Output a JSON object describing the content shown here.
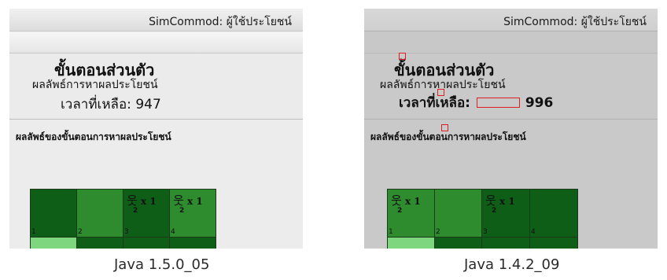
{
  "panels": [
    {
      "window_title": "SimCommod: ผู้ใช้ประโยชน์",
      "main_heading": "ขั้นตอนส่วนตัว",
      "sub_heading": "ผลลัพธ์การหาผลประโยชน์",
      "time_label": "เวลาที่เหลือ:",
      "time_value": "947",
      "results_title": "ผลลัพธ์ของขั้นตอนการหาผลประโยชน์",
      "grid_cells": [
        {
          "number": "1",
          "color": "#0e5e17",
          "agent_label": "",
          "agent_count": ""
        },
        {
          "number": "2",
          "color": "#2e8b2e",
          "agent_label": "",
          "agent_count": ""
        },
        {
          "number": "3",
          "color": "#0e5e17",
          "agent_label": "x 1",
          "agent_count": "2"
        },
        {
          "number": "4",
          "color": "#2e8b2e",
          "agent_label": "x 1",
          "agent_count": "2"
        }
      ],
      "grid_row2_colors": [
        "#7ed67e",
        "#0e5e17",
        "#0e5e17",
        "#0e5e17"
      ],
      "caption": "Java 1.5.0_05"
    },
    {
      "window_title": "SimCommod: ผู้ใช้ประโยชน์",
      "main_heading": "ขั้นตอนส่วนตัว",
      "sub_heading": "ผลลัพธ์การหาผลประโยชน์",
      "time_label": "เวลาที่เหลือ:",
      "time_value": "996",
      "results_title": "ผลลัพธ์ของขั้นตอนการหาผลประโยชน์",
      "grid_cells": [
        {
          "number": "1",
          "color": "#2e8b2e",
          "agent_label": "x 1",
          "agent_count": "2"
        },
        {
          "number": "2",
          "color": "#2e8b2e",
          "agent_label": "",
          "agent_count": ""
        },
        {
          "number": "3",
          "color": "#0e5e17",
          "agent_label": "x 1",
          "agent_count": "2"
        },
        {
          "number": "4",
          "color": "#0e5e17",
          "agent_label": "",
          "agent_count": ""
        }
      ],
      "grid_row2_colors": [
        "#7ed67e",
        "#0e5e17",
        "#0e5e17",
        "#0e5e17"
      ],
      "caption": "Java 1.4.2_09"
    }
  ],
  "colors": {
    "debug_outline": "#e02020",
    "dark_green": "#0e5e17",
    "mid_green": "#2e8b2e",
    "light_green": "#7ed67e"
  },
  "icons": {
    "agent": "stick-figure-icon"
  }
}
